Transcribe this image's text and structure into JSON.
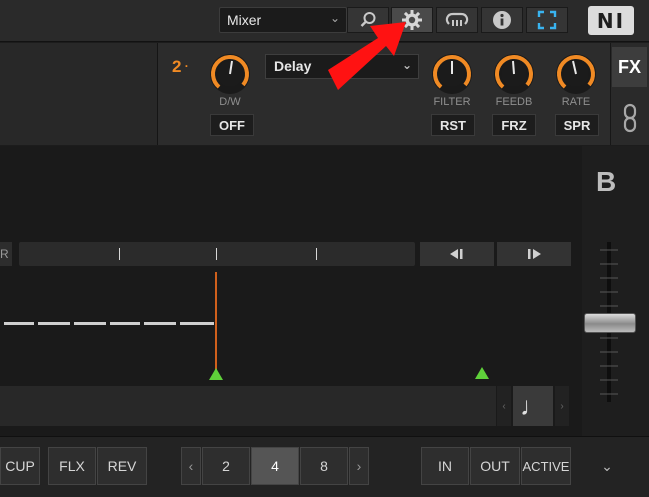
{
  "topbar": {
    "mixer_select_value": "Mixer",
    "buttons": [
      "search-icon",
      "gear-icon",
      "loop-icon",
      "info-icon",
      "fullscreen-icon"
    ],
    "logo": "NI"
  },
  "fx_unit": {
    "number": "2",
    "effect": "Delay",
    "dw": {
      "label": "D/W",
      "button": "OFF"
    },
    "filter": {
      "label": "FILTER",
      "button": "RST"
    },
    "feedb": {
      "label": "FEEDB",
      "button": "FRZ"
    },
    "rate": {
      "label": "RATE",
      "button": "SPR"
    },
    "side_button": "FX",
    "accent_color": "#f08a24"
  },
  "deck": {
    "letter": "B",
    "strip_left_label": "R",
    "quantize_icon": "note-icon"
  },
  "bottombar": {
    "cup": "CUP",
    "flx": "FLX",
    "rev": "REV",
    "prev": "‹",
    "sizes": [
      "2",
      "4",
      "8"
    ],
    "selected_size": "4",
    "next": "›",
    "in": "IN",
    "out": "OUT",
    "active": "ACTIVE",
    "expand": "⌄"
  },
  "overlay": {
    "arrow_color": "#ff1212"
  }
}
